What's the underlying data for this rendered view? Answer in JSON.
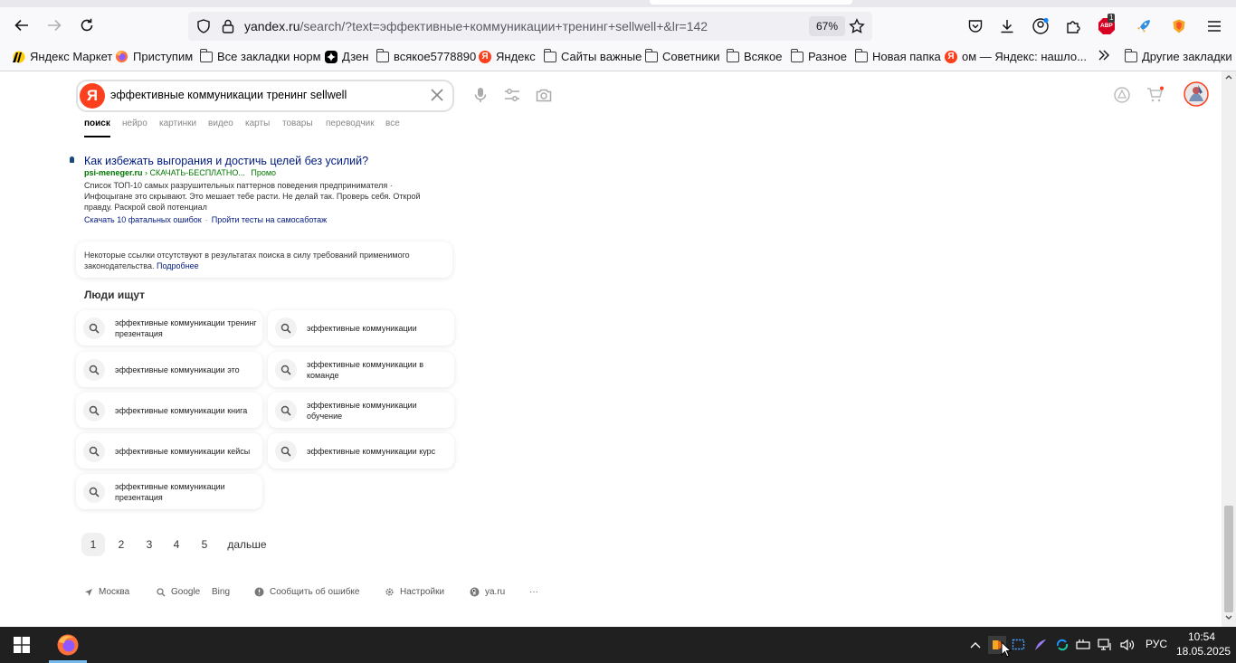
{
  "browser": {
    "url_host": "yandex.ru",
    "url_path": "/search/?text=эффективные+коммуникации+тренинг+sellwell+&lr=142",
    "zoom": "67%",
    "ext_abp_badge": "1",
    "ext_abp_label": "ABP"
  },
  "bookmarks": [
    {
      "label": "Яндекс Маркет",
      "icon": "yandex-market-icon"
    },
    {
      "label": "Приступим",
      "icon": "firefox-icon"
    },
    {
      "label": "Все закладки норм",
      "icon": "folder-icon"
    },
    {
      "label": "Дзен",
      "icon": "dzen-icon"
    },
    {
      "label": "всякое5778890",
      "icon": "folder-icon"
    },
    {
      "label": "Яндекс",
      "icon": "yandex-icon"
    },
    {
      "label": "Сайты важные",
      "icon": "folder-icon"
    },
    {
      "label": "Советники",
      "icon": "folder-icon"
    },
    {
      "label": "Всякое",
      "icon": "folder-icon"
    },
    {
      "label": "Разное",
      "icon": "folder-icon"
    },
    {
      "label": "Новая папка",
      "icon": "folder-icon"
    },
    {
      "label": "ом — Яндекс: нашло...",
      "icon": "yandex-icon"
    }
  ],
  "bookmarks_other": "Другие закладки",
  "search": {
    "logo_letter": "Я",
    "query": "эффективные коммуникации тренинг sellwell",
    "tabs": [
      "поиск",
      "нейро",
      "картинки",
      "видео",
      "карты",
      "товары",
      "переводчик",
      "все"
    ]
  },
  "ad": {
    "title": "Как избежать выгорания и достичь целей без усилий?",
    "domain": "psi-meneger.ru",
    "path": "› СКАЧАТЬ-БЕСПЛАТНО...",
    "promo": "Промо",
    "description": "Список ТОП-10 самых разрушительных паттернов поведения предпринимателя · Инфоцыгане это скрывают. Это мешает тебе расти. Не делай так. Проверь себя. Открой правду. Раскрой свой потенциал",
    "links": [
      "Скачать 10 фатальных ошибок",
      "Пройти тесты на самосаботаж"
    ]
  },
  "notice": {
    "text": "Некоторые ссылки отсутствуют в результатах поиска в силу требований применимого законодательства.",
    "more": "Подробнее"
  },
  "people_search": {
    "heading": "Люди ищут",
    "items": [
      "эффективные коммуникации тренинг презентация",
      "эффективные коммуникации",
      "эффективные коммуникации это",
      "эффективные коммуникации в команде",
      "эффективные коммуникации книга",
      "эффективные коммуникации обучение",
      "эффективные коммуникации кейсы",
      "эффективные коммуникации курс",
      "эффективные коммуникации презентация"
    ]
  },
  "pager": {
    "pages": [
      "1",
      "2",
      "3",
      "4",
      "5"
    ],
    "next": "дальше"
  },
  "footer": {
    "location": "Москва",
    "google": "Google",
    "bing": "Bing",
    "report": "Сообщить об ошибке",
    "settings": "Настройки",
    "ya": "ya.ru",
    "more": "···"
  },
  "taskbar": {
    "lang": "РУС",
    "time": "10:54",
    "date": "18.05.2025"
  },
  "colors": {
    "yandex_red": "#fc3f1d",
    "link_blue": "#001a80",
    "ad_green": "#007700"
  }
}
